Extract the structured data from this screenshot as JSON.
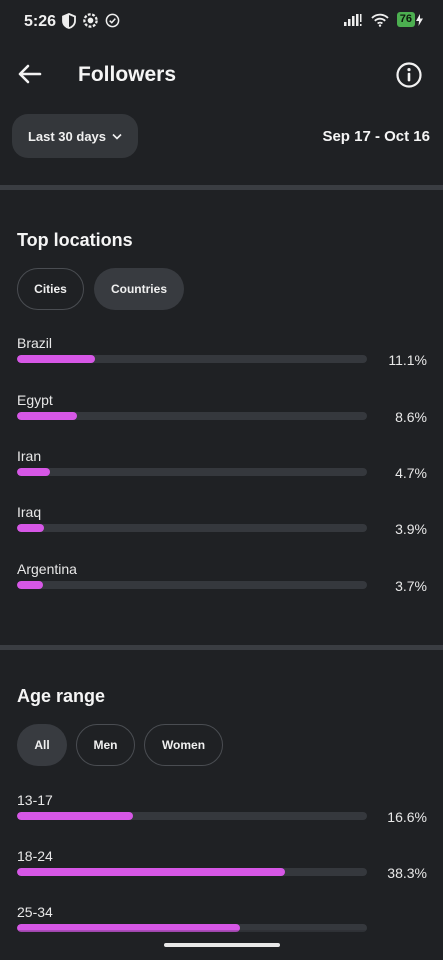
{
  "status": {
    "time": "5:26",
    "battery": "76",
    "left_icons": [
      "shield-icon",
      "settings-gear-icon",
      "check-circle-icon"
    ],
    "right_icons": [
      "signal-icon",
      "wifi-icon",
      "battery-icon"
    ]
  },
  "header": {
    "title": "Followers",
    "back_icon": "arrow-left-icon",
    "info_icon": "info-icon"
  },
  "filter": {
    "range_label": "Last 30 days",
    "date_range": "Sep 17 - Oct 16"
  },
  "locations": {
    "title": "Top locations",
    "tabs": [
      {
        "label": "Cities",
        "selected": false
      },
      {
        "label": "Countries",
        "selected": true
      }
    ],
    "items": [
      {
        "label": "Brazil",
        "value": "11.1%",
        "fraction": 0.111
      },
      {
        "label": "Egypt",
        "value": "8.6%",
        "fraction": 0.086
      },
      {
        "label": "Iran",
        "value": "4.7%",
        "fraction": 0.047
      },
      {
        "label": "Iraq",
        "value": "3.9%",
        "fraction": 0.039
      },
      {
        "label": "Argentina",
        "value": "3.7%",
        "fraction": 0.037
      }
    ]
  },
  "age": {
    "title": "Age range",
    "tabs": [
      {
        "label": "All",
        "selected": true
      },
      {
        "label": "Men",
        "selected": false
      },
      {
        "label": "Women",
        "selected": false
      }
    ],
    "items": [
      {
        "label": "13-17",
        "value": "16.6%",
        "fraction": 0.166
      },
      {
        "label": "18-24",
        "value": "38.3%",
        "fraction": 0.383
      },
      {
        "label": "25-34",
        "value": "",
        "fraction": 0.318
      }
    ]
  },
  "colors": {
    "background": "#1f2124",
    "bar_fill": "#d657e6",
    "bar_track": "#35383d",
    "chip_selected": "#383b40"
  }
}
